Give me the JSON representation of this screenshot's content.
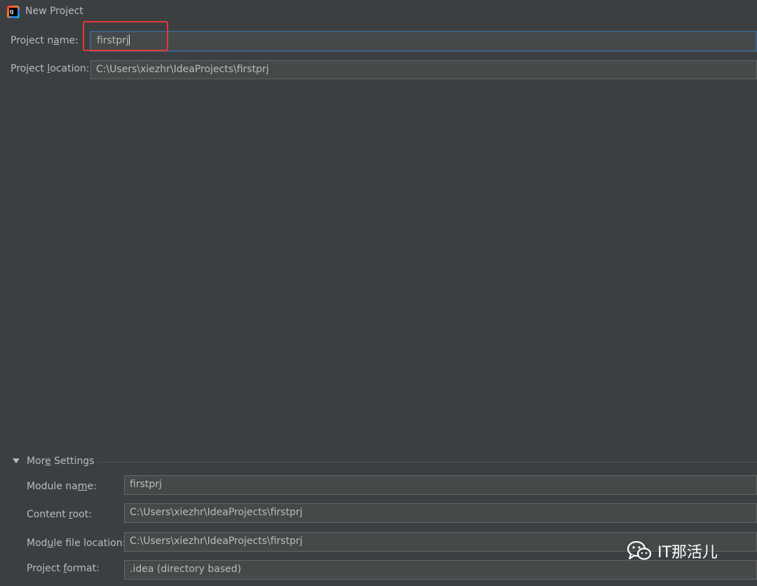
{
  "window": {
    "title": "New Project",
    "app_icon": "intellij-idea-icon"
  },
  "form": {
    "project_name_label_pre": "Project n",
    "project_name_label_mn": "a",
    "project_name_label_post": "me:",
    "project_name_value": "firstprj",
    "project_location_label_pre": "Project ",
    "project_location_label_mn": "l",
    "project_location_label_post": "ocation:",
    "project_location_value": "C:\\Users\\xiezhr\\IdeaProjects\\firstprj"
  },
  "more_settings": {
    "toggle_pre": "Mor",
    "toggle_mn": "e",
    "toggle_post": " Settings",
    "module_name_label_pre": "Module na",
    "module_name_label_mn": "m",
    "module_name_label_post": "e:",
    "module_name_value": "firstprj",
    "content_root_label_pre": "Content ",
    "content_root_label_mn": "r",
    "content_root_label_post": "oot:",
    "content_root_value": "C:\\Users\\xiezhr\\IdeaProjects\\firstprj",
    "module_file_label_pre": "Mod",
    "module_file_label_mn": "u",
    "module_file_label_post": "le file location:",
    "module_file_value": "C:\\Users\\xiezhr\\IdeaProjects\\firstprj",
    "project_format_label_pre": "Project ",
    "project_format_label_mn": "f",
    "project_format_label_post": "ormat:",
    "project_format_value": ".idea (directory based)"
  },
  "watermark": {
    "text": "IT那活儿",
    "icon": "wechat-icon"
  },
  "colors": {
    "highlight": "#e53935",
    "focus": "#3d6185",
    "background": "#3c3f41"
  }
}
